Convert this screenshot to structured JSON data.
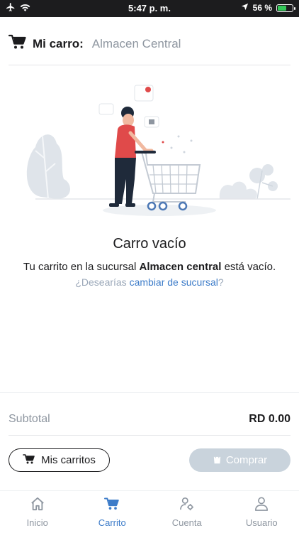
{
  "status_bar": {
    "time": "5:47 p. m.",
    "battery_percent": "56 %",
    "battery_level": 0.56,
    "icons": [
      "airplane-icon",
      "wifi-icon",
      "location-icon",
      "battery-icon"
    ]
  },
  "header": {
    "title": "Mi carro:",
    "branch": "Almacen Central",
    "icon": "cart-icon"
  },
  "empty_state": {
    "title": "Carro vacío",
    "message_prefix": "Tu carrito en la sucursal ",
    "message_branch": "Almacen central",
    "message_suffix": " está vacío.",
    "hint_prefix": "¿Desearías ",
    "hint_link": "cambiar de sucursal",
    "hint_suffix": "?"
  },
  "summary": {
    "subtotal_label": "Subtotal",
    "subtotal_value": "RD 0.00"
  },
  "actions": {
    "my_carts_label": "Mis carritos",
    "buy_label": "Comprar"
  },
  "tabs": [
    {
      "label": "Inicio",
      "icon": "home-icon",
      "active": false
    },
    {
      "label": "Carrito",
      "icon": "cart-icon",
      "active": true
    },
    {
      "label": "Cuenta",
      "icon": "account-settings-icon",
      "active": false
    },
    {
      "label": "Usuario",
      "icon": "user-icon",
      "active": false
    }
  ],
  "colors": {
    "accent": "#3d7cc9",
    "disabled_button": "#c9d3dc",
    "muted_text": "#8e96a0",
    "illustration_shirt": "#e04a4a"
  }
}
